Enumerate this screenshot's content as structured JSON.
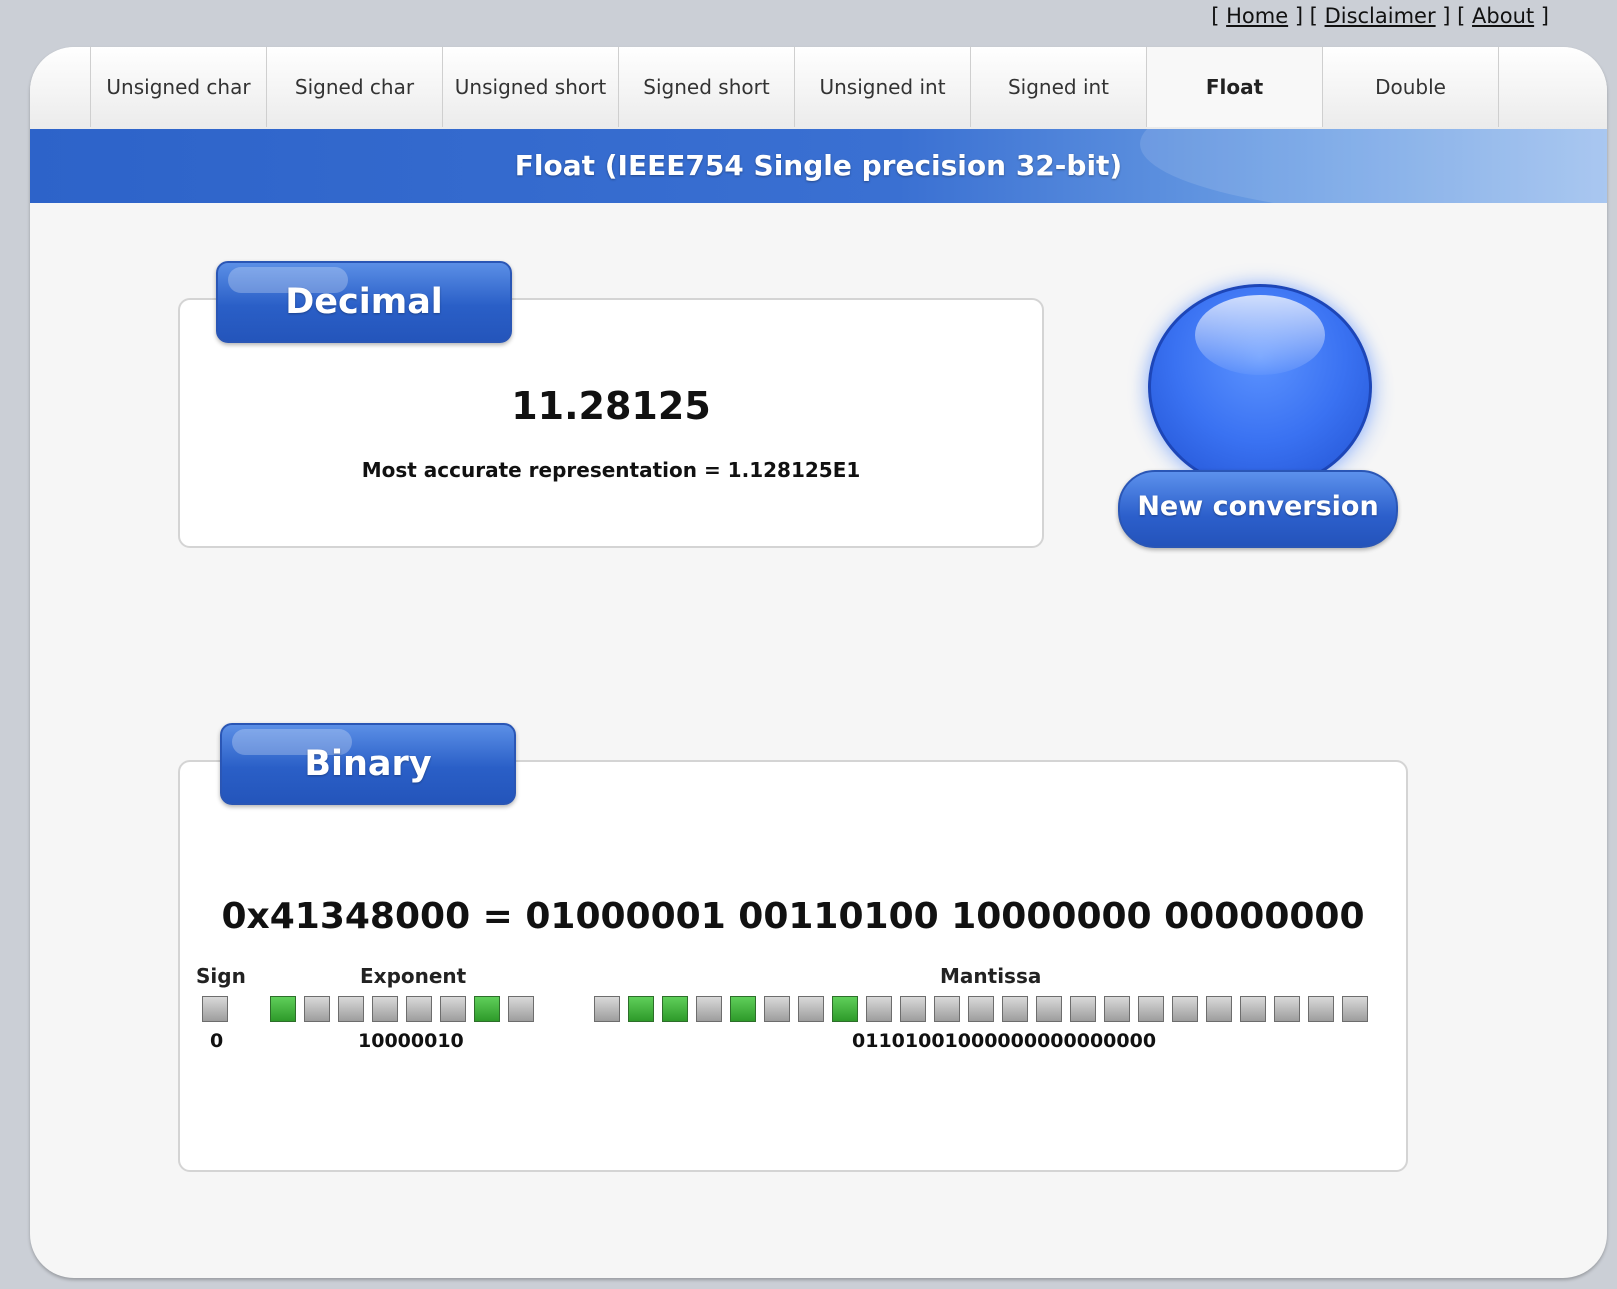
{
  "top_links": {
    "home": "Home",
    "disclaimer": "Disclaimer",
    "about": "About"
  },
  "tabs": [
    {
      "label": "Unsigned char"
    },
    {
      "label": "Signed char"
    },
    {
      "label": "Unsigned short"
    },
    {
      "label": "Signed short"
    },
    {
      "label": "Unsigned int"
    },
    {
      "label": "Signed int"
    },
    {
      "label": "Float",
      "active": true
    },
    {
      "label": "Double"
    }
  ],
  "title": "Float (IEEE754 Single precision 32-bit)",
  "decimal": {
    "heading": "Decimal",
    "value": "11.28125",
    "accurate": "Most accurate representation = 1.128125E1"
  },
  "new_conversion": {
    "label": "New conversion"
  },
  "binary": {
    "heading": "Binary",
    "hex_line": "0x41348000 = 01000001 00110100 10000000 00000000",
    "sign": {
      "label": "Sign",
      "bits": "0"
    },
    "exponent": {
      "label": "Exponent",
      "bits": "10000010"
    },
    "mantissa": {
      "label": "Mantissa",
      "bits": "01101001000000000000000"
    }
  },
  "colors": {
    "bit_on": "#3bb236",
    "bit_off": "#b5b5b5",
    "accent": "#2d63c9"
  }
}
